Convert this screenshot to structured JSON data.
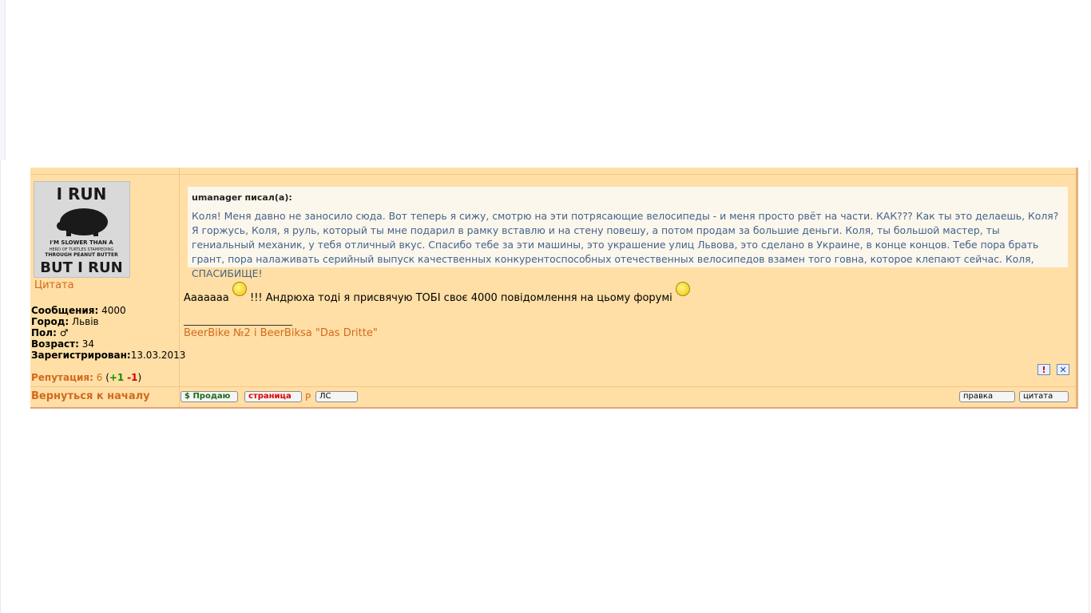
{
  "post": {
    "author_block": {
      "avatar_lines": [
        "I RUN",
        "I'M SLOWER THAN A",
        "HERD OF TURTLES STAMPEDING",
        "THROUGH PEANUT BUTTER",
        "BUT I RUN"
      ],
      "quote_link": "Цитата",
      "profile": {
        "messages_label": "Сообщения:",
        "messages_value": "4000",
        "city_label": "Город:",
        "city_value": "Львів",
        "gender_label": "Пол:",
        "gender_value": "♂",
        "age_label": "Возраст:",
        "age_value": "34",
        "registered_label": "Зарегистрирован:",
        "registered_value": "13.03.2013"
      },
      "reputation": {
        "label": "Репутация:",
        "value": "6",
        "plus": "+1",
        "minus": "-1"
      },
      "back_to_top": "Вернуться к началу"
    },
    "quote": {
      "author": "umanager писал(а):",
      "text": "Коля! Меня давно не заносило сюда. Вот теперь я сижу, смотрю на эти потрясающие велосипеды - и меня просто рвёт на части. КАК??? Как ты это делаешь, Коля? Я горжусь, Коля, я руль, который ты мне подарил в рамку вставлю и на стену повешу, а потом продам за большие деньги. Коля, ты большой мастер, ты гениальный механик, у тебя отличный вкус. Спасибо тебе за эти машины, это украшение улиц Львова, это сделано в Украине, в конце концов. Тебе пора брать грант, пора налаживать серийный выпуск качественных конкурентоспособных отечественных велосипедов взамен того говна, которое клепают сейчас. Коля, СПАСИБИЩЕ!"
    },
    "message": {
      "part1": "Ааааааа",
      "part2": "!!! Андрюха тоді я присвячую ТОБІ своє 4000 повідомлення на цьому форумі"
    },
    "signature": "BeerBike №2 і BeerBiksa \"Das Dritte\"",
    "buttons": {
      "sell": "$ Продаю",
      "page": "страница",
      "p": "P",
      "pm": "ЛС",
      "edit": "правка",
      "quote": "цитата",
      "report": "!",
      "delete": "✕"
    }
  },
  "colors": {
    "post_bg": "#ffdfa5",
    "accent_orange": "#d2691e",
    "quote_text": "#45628a"
  }
}
